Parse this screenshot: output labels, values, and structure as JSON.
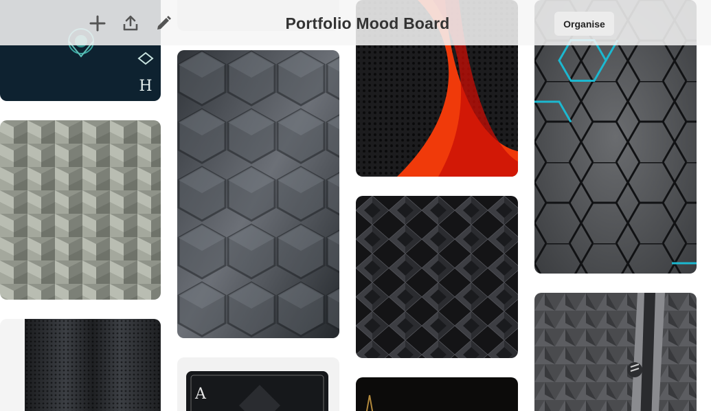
{
  "header": {
    "title": "Portfolio Mood Board",
    "organise_label": "Organise",
    "tools": [
      {
        "name": "add",
        "icon": "plus-icon"
      },
      {
        "name": "share",
        "icon": "upload-icon"
      },
      {
        "name": "edit",
        "icon": "pencil-icon"
      }
    ]
  },
  "pins": [
    {
      "name": "navy-ornament-card",
      "description_icon": "mandala-ornament"
    },
    {
      "name": "grey-woven-tiles"
    },
    {
      "name": "dark-mesh-panel"
    },
    {
      "name": "3d-grey-hexagons"
    },
    {
      "name": "card-with-ornament-letter-a",
      "letter": "A"
    },
    {
      "name": "red-curve-on-mesh"
    },
    {
      "name": "black-geometric-stars"
    },
    {
      "name": "black-gold-card"
    },
    {
      "name": "hexagon-grid-cyan-glow"
    },
    {
      "name": "grey-backpack-texture"
    }
  ],
  "colors": {
    "topbar": "#f6f6f6",
    "title": "#333333",
    "icon": "#555555",
    "organise_bg": "#ececec",
    "accent_red": "#f03a0a",
    "accent_cyan": "#1cb8d0",
    "navy": "#0e2230"
  }
}
